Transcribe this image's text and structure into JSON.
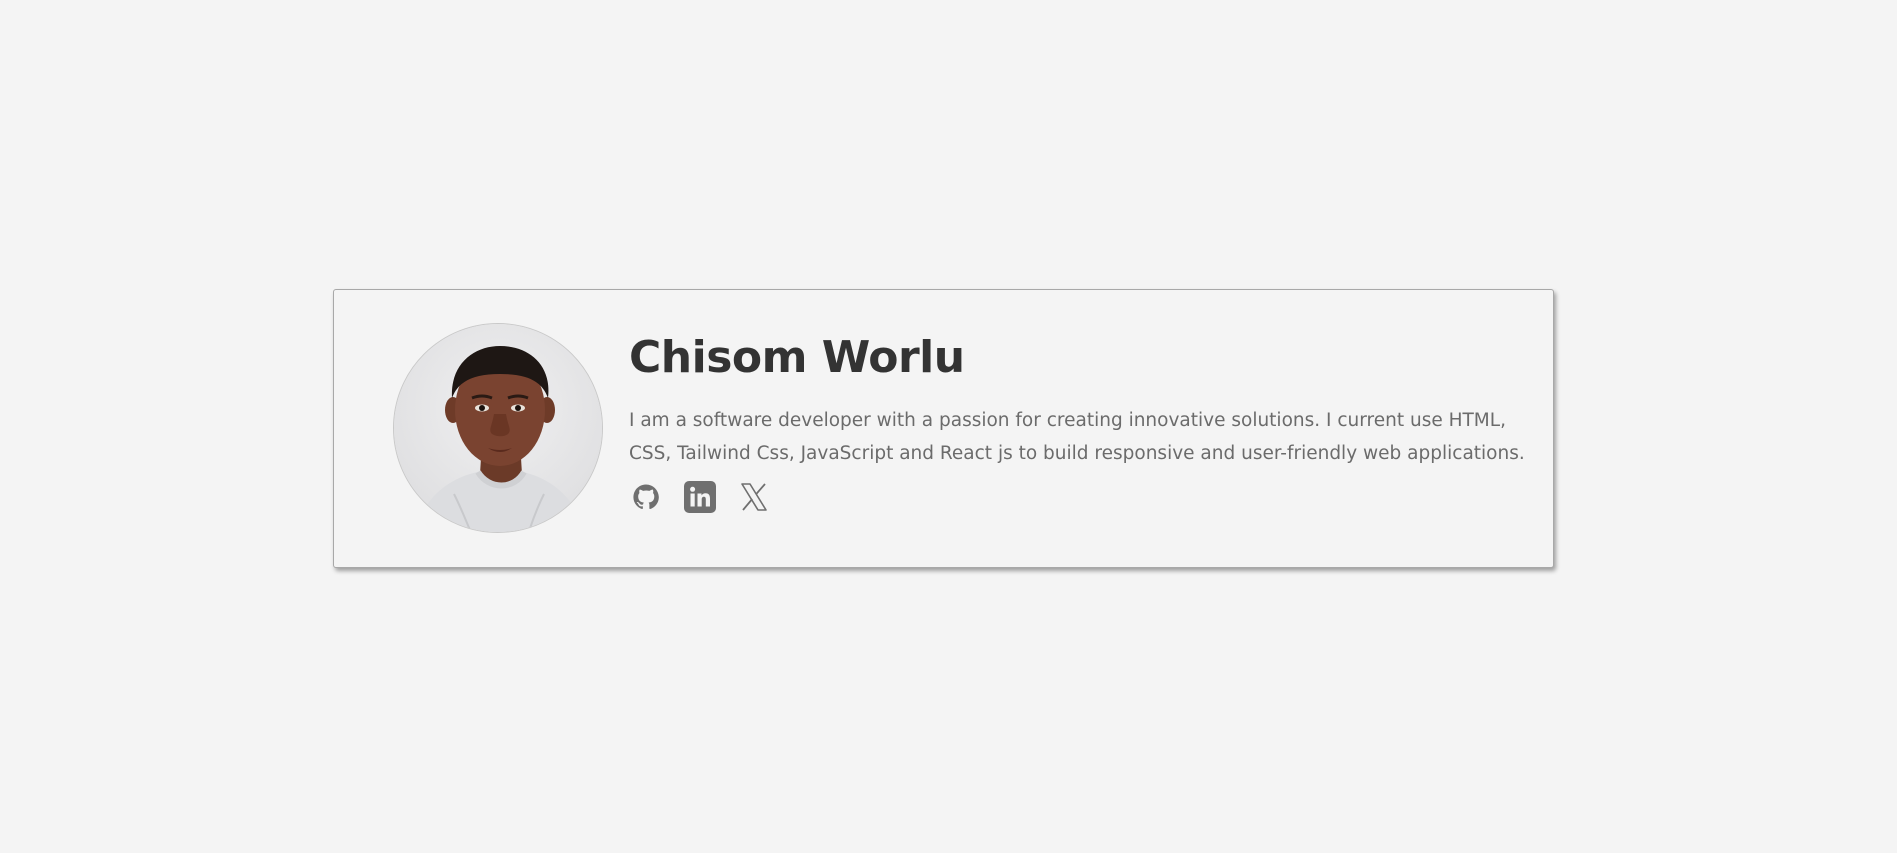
{
  "profile": {
    "name": "Chisom Worlu",
    "bio": "I am a software developer with a passion for creating innovative solutions. I current use HTML, CSS, Tailwind Css, JavaScript and React js to build responsive and user-friendly web applications.",
    "avatar_alt": "Chisom Worlu profile photo"
  },
  "socials": [
    {
      "name": "GitHub",
      "icon": "github-icon"
    },
    {
      "name": "LinkedIn",
      "icon": "linkedin-icon"
    },
    {
      "name": "X",
      "icon": "x-icon"
    }
  ],
  "colors": {
    "background": "#f4f4f4",
    "card_border": "#a8a8a8",
    "name_text": "#333333",
    "bio_text": "#6b6b6b",
    "icon": "#6f6f6f"
  }
}
